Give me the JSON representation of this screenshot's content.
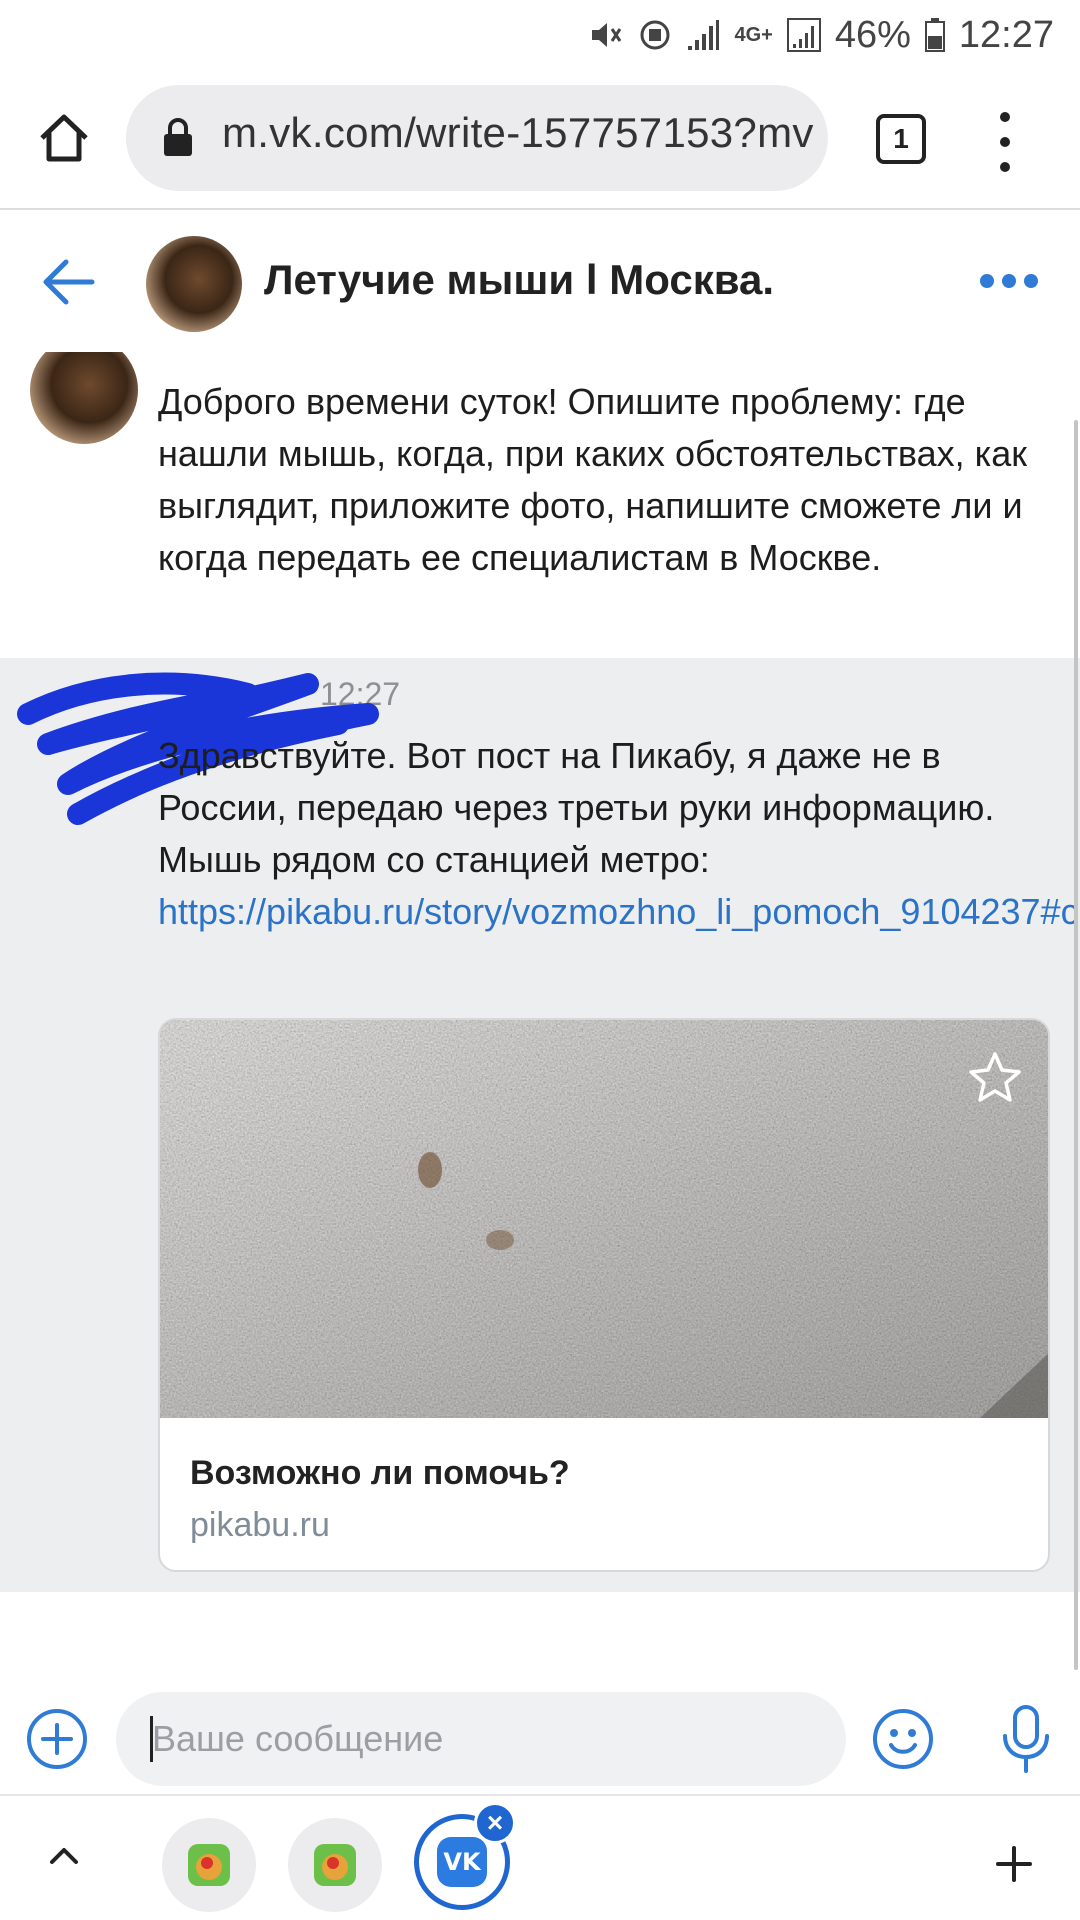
{
  "status_bar": {
    "battery": "46%",
    "time": "12:27",
    "network": "4G+"
  },
  "browser": {
    "url": "m.vk.com/write-157757153?mv",
    "tab_count": "1"
  },
  "chat": {
    "title": "Летучие мыши l Москва."
  },
  "messages": [
    {
      "text": "Доброго времени суток! Опишите проблему: где нашли мышь, когда, при каких обстоятельствах, как выглядит, приложите фото, напишите сможете ли и когда передать ее специалистам в Москве."
    },
    {
      "time": "12:27",
      "text": "Здравствуйте. Вот пост на Пикабу, я даже не в России, передаю через третьи руки информацию. Мышь рядом со станцией метро:",
      "link": "https://pikabu.ru/story/vozmozhno_li_pomoch_9104237#c..",
      "card": {
        "title": "Возможно ли помочь?",
        "domain": "pikabu.ru"
      }
    }
  ],
  "composer": {
    "placeholder": "Ваше сообщение"
  },
  "colors": {
    "accent": "#2a73c8",
    "received_bg": "#edeef0",
    "scribble": "#1a36d9"
  }
}
